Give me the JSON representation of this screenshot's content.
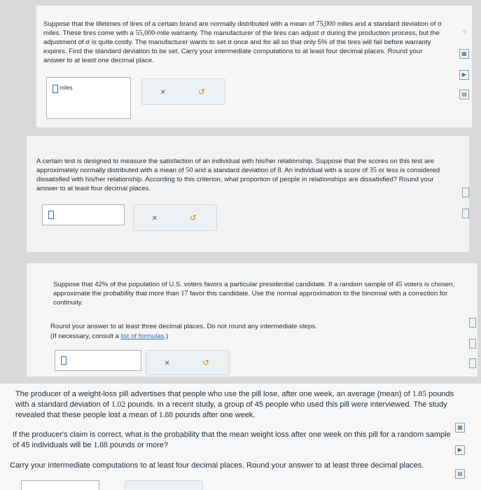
{
  "panel1": {
    "question_pre": "Suppose that the lifetimes of tires of a certain brand are normally distributed with a mean of ",
    "mean": "75,000",
    "question_mid1": " miles and a standard deviation of σ miles. These tires come with a ",
    "warranty": "55,000",
    "question_mid2": "-mile warranty. The manufacturer of the tires can adjust σ during the production process, but the adjustment of σ is quite costly. The manufacturer wants to set σ once and for all so that only ",
    "percent": "5%",
    "question_post": " of the tires will fail before warranty expires. Find the standard deviation to be set. Carry your intermediate computations to at least four decimal places. Round your answer to at least one decimal place.",
    "unit": "miles",
    "clear_label": "×",
    "undo_label": "↺",
    "help_label": "?"
  },
  "panel2": {
    "question_pre": "A certain test is designed to measure the satisfaction of an individual with his/her relationship. Suppose that the scores on this test are approximately normally distributed with a mean of ",
    "mean": "50",
    "question_mid1": " and a standard deviation of ",
    "sd": "8",
    "question_mid2": ". An individual with a score of ",
    "score": "35",
    "question_post": " or less is considered dissatisfied with his/her relationship. According to this criterion, what proportion of people in relationships are dissatisfied? Round your answer to at least four decimal places.",
    "clear_label": "×",
    "undo_label": "↺"
  },
  "panel3": {
    "question_pre": "Suppose that ",
    "percent": "42%",
    "question_mid1": " of the population of U.S. voters favors a particular presidential candidate. If a random sample of ",
    "n": "45",
    "question_mid2": " voters is chosen, approximate the probability that more than ",
    "k": "17",
    "question_post": " favor this candidate. Use the normal approximation to the binomial with a correction for continuity.",
    "round_text": "Round your answer to at least three decimal places. Do not round any intermediate steps.",
    "consult_pre": "(If necessary, consult a ",
    "consult_link": "list of formulas",
    "consult_post": ".)",
    "clear_label": "×",
    "undo_label": "↺"
  },
  "panel4": {
    "question_pre": "The producer of a weight-loss pill advertises that people who use the pill lose, after one week, an average (mean) of ",
    "mean": "1.85",
    "question_mid1": " pounds with a standard deviation of ",
    "sd": "1.02",
    "question_mid2": " pounds. In a recent study, a group of ",
    "n": "45",
    "question_mid3": " people who used this pill were interviewed. The study revealed that these people lost a mean of ",
    "sample_mean": "1.88",
    "question_post": " pounds after one week.",
    "claim_pre": "If the producer's claim is correct, what is the probability that the mean weight loss after one week on this pill for a random sample of ",
    "claim_n": "45",
    "claim_mid": " individuals will be ",
    "claim_value": "1.88",
    "claim_post": " pounds or more?",
    "carry_text": "Carry your intermediate computations to at least four decimal places. Round your answer to at least three decimal places."
  }
}
